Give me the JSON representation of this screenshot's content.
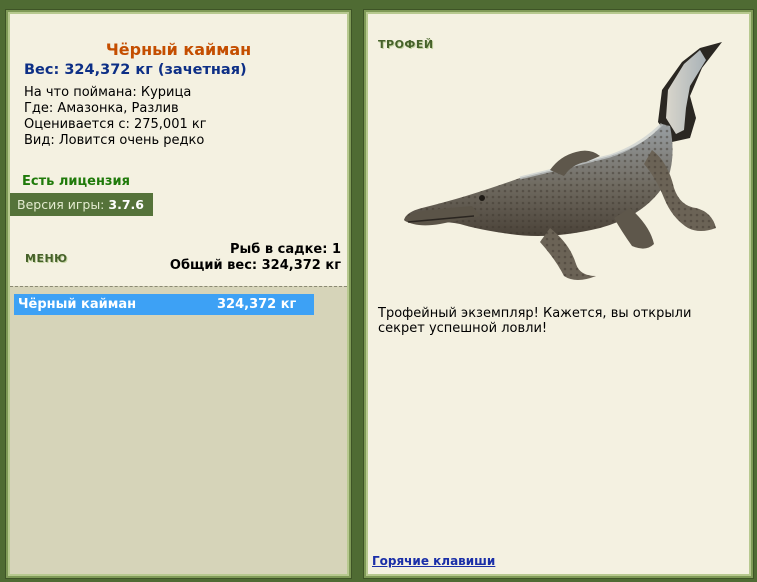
{
  "fish": {
    "name": "Чёрный кайман",
    "weight_line": "Вес: 324,372 кг (зачетная)",
    "bait_line": "На что поймана: Курица",
    "location_line": "Где: Амазонка, Разлив",
    "value_line": "Оценивается с: 275,001 кг",
    "rarity_line": "Вид: Ловится очень редко"
  },
  "license": "Есть лицензия",
  "version": {
    "label": "Версия игры:",
    "value": "3.7.6"
  },
  "menu_label": "МЕНЮ",
  "keepnet": {
    "count_line": "Рыб в садке: 1",
    "total_line": "Общий вес: 324,372 кг",
    "items": [
      {
        "name": "Чёрный кайман",
        "weight": "324,372 кг"
      }
    ]
  },
  "trophy": {
    "label": "ТРОФЕЙ",
    "image_icon": "caiman-image",
    "message": "Трофейный экземпляр! Кажется, вы открыли секрет успешной ловли!",
    "hotkeys_link": "Горячие клавиши"
  },
  "colors": {
    "frame": "#4f6b33",
    "panel": "#f4f1e1",
    "title": "#c44e00",
    "weight": "#0d2f86",
    "license": "#1f7a0a",
    "selection": "#3da1f5",
    "link": "#1a2fa8"
  }
}
